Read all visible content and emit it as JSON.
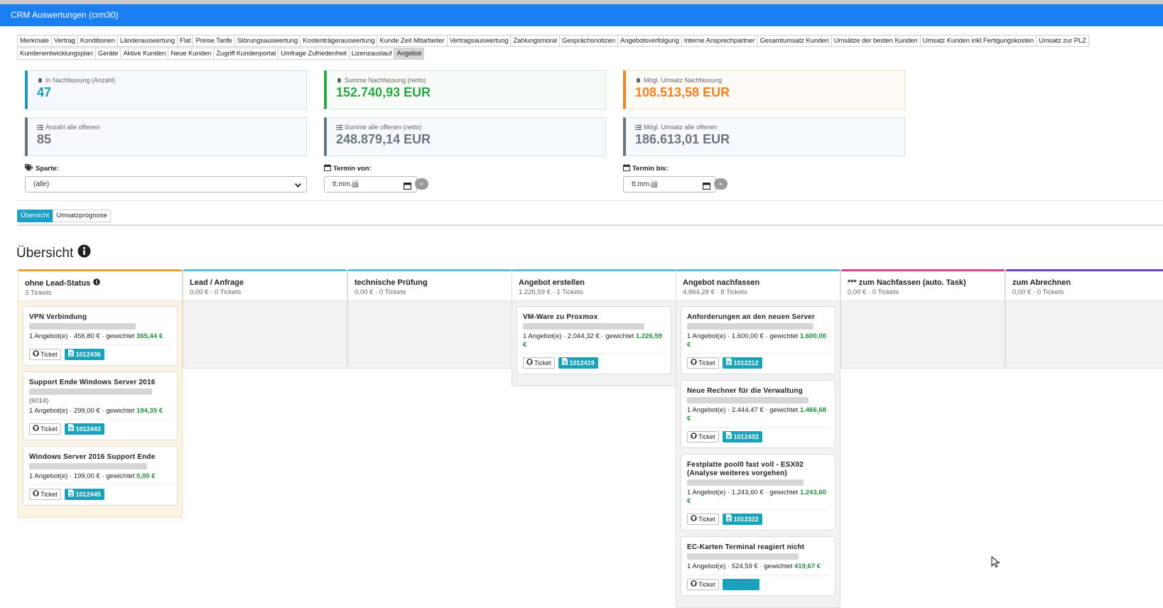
{
  "window": {
    "title": "CRM Auswertungen (crm30)"
  },
  "tabs_row1": [
    "Merkmale",
    "Vertrag",
    "Konditionen",
    "Länderauswertung",
    "Flat",
    "Preise Tarife",
    "Störungsauswertung",
    "Kostenträgerauswertung",
    "Kunde Zeit Mitarbeiter",
    "Vertragsauswertung",
    "Zahlungsmoral",
    "Gesprächsnotizen",
    "Angebotsverfolgung",
    "Interne Ansprechpartner",
    "Gesamtumsatz Kunden",
    "Umsätze der besten Kunden",
    "Umsatz Kunden inkl Fertigungskosten",
    "Umsatz zur PLZ"
  ],
  "tabs_row2": [
    "Kundenentwicklungsplan",
    "Geräte",
    "Aktive Kunden",
    "Neue Kunden",
    "Zugriff Kundenportal",
    "Umfrage Zufriedenheit",
    "Lizenzauslauf",
    "Angebot"
  ],
  "active_tab": "Angebot",
  "kpis": {
    "nachfassung_anzahl": {
      "label": "In Nachfassung (Anzahl)",
      "value": "47",
      "color": "#1a9ab8",
      "icon": "bell-icon"
    },
    "nachfassung_summe": {
      "label": "Summe Nachfassung (netto)",
      "value": "152.740,93 EUR",
      "color": "#28a745",
      "icon": "bell-icon"
    },
    "nachfassung_umsatz": {
      "label": "Mögl. Umsatz Nachfassung",
      "value": "108.513,58 EUR",
      "color": "#f7801e",
      "icon": "bell-icon"
    },
    "offen_anzahl": {
      "label": "Anzahl alle offenen",
      "value": "85",
      "color": "#6c757d",
      "icon": "list-icon"
    },
    "offen_summe": {
      "label": "Summe alle offenen (netto)",
      "value": "248.879,14 EUR",
      "color": "#6c757d",
      "icon": "list-icon"
    },
    "offen_umsatz": {
      "label": "Mögl. Umsatz alle offenen",
      "value": "186.613,01 EUR",
      "color": "#6c757d",
      "icon": "list-icon"
    }
  },
  "filters": {
    "sparte_label": "Sparte:",
    "sparte_value": "(alle)",
    "termin_von_label": "Termin von:",
    "termin_von_placeholder": "tt.mm.jjjj",
    "termin_bis_label": "Termin bis:",
    "termin_bis_placeholder": "tt.mm.jjjj",
    "clear": "×"
  },
  "view_buttons": {
    "overview": "Übersicht",
    "forecast": "Umsatzprognose"
  },
  "section_title": "Übersicht",
  "columns": [
    {
      "name": "ohne Lead-Status",
      "summary": "3 Tickets",
      "color": "#f0a030",
      "bg": "#fbf4e4",
      "info": true,
      "cards": [
        {
          "title": "VPN Verbindung",
          "info_pre": "1 Angebot(e) · 456,80 € · gewichtet ",
          "weighted": "365,44 €",
          "ticket": "Ticket",
          "number": "1012436"
        },
        {
          "title": "Support Ende Windows Server 2016",
          "extra": "(6014)",
          "info_pre": "1 Angebot(e) · 299,00 € · gewichtet ",
          "weighted": "194,35 €",
          "ticket": "Ticket",
          "number": "1012443"
        },
        {
          "title": "Windows Server 2016 Support Ende",
          "info_pre": "1 Angebot(e) · 199,00 € · gewichtet ",
          "weighted": "0,00 €",
          "ticket": "Ticket",
          "number": "1012445"
        }
      ]
    },
    {
      "name": "Lead / Anfrage",
      "summary": "0,00 € · 0 Tickets",
      "color": "#5bc0de",
      "cards": []
    },
    {
      "name": "technische Prüfung",
      "summary": "0,00 € · 0 Tickets",
      "color": "#5bc0de",
      "cards": []
    },
    {
      "name": "Angebot erstellen",
      "summary": "1.226,59 € · 1 Tickets",
      "color": "#5bc0de",
      "cards": [
        {
          "title": "VM-Ware zu Proxmox",
          "info_pre": "1 Angebot(e) · 2.044,32 € · gewichtet ",
          "weighted": "1.226,59 €",
          "ticket": "Ticket",
          "number": "1012419"
        }
      ]
    },
    {
      "name": "Angebot nachfassen",
      "summary": "4.864,28 € · 8 Tickets",
      "color": "#5bc0de",
      "cards": [
        {
          "title": "Anforderungen an den neuen Server",
          "info_pre": "1 Angebot(e) · 1.600,00 € · gewichtet ",
          "weighted": "1.600,00 €",
          "ticket": "Ticket",
          "number": "1012212"
        },
        {
          "title": "Neue Rechner für die Verwaltung",
          "info_pre": "1 Angebot(e) · 2.444,47 € · gewichtet ",
          "weighted": "1.466,68 €",
          "ticket": "Ticket",
          "number": "1012433"
        },
        {
          "title": "Festplatte pool0 fast voll - ESX02 (Analyse weiteres vorgehen)",
          "info_pre": "1 Angebot(e) · 1.243,60 € · gewichtet ",
          "weighted": "1.243,60 €",
          "ticket": "Ticket",
          "number": "1012322"
        },
        {
          "title": "EC-Karten Terminal reagiert nicht",
          "info_pre": "1 Angebot(e) · 524,59 € · gewichtet ",
          "weighted": "419,67 €",
          "ticket": "Ticket",
          "number": ""
        }
      ]
    },
    {
      "name": "*** zum Nachfassen (auto. Task)",
      "summary": "0,00 € · 0 Tickets",
      "color": "#e83e8c",
      "cards": []
    },
    {
      "name": "zum Abrechnen",
      "summary": "0,00 € · 0 Tickets",
      "color": "#6f42c1",
      "cards": []
    }
  ]
}
